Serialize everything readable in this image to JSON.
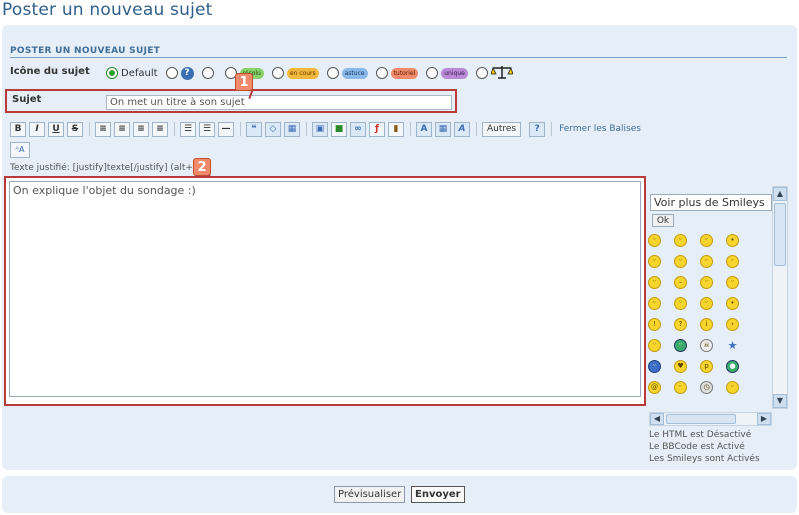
{
  "page": {
    "title": "Poster un nouveau sujet"
  },
  "form": {
    "heading": "POSTER UN NOUVEAU SUJET",
    "icon_label": "Icône du sujet",
    "icon_options": [
      {
        "label": "Default",
        "selected": true,
        "icon": "none"
      },
      {
        "label": "",
        "selected": false,
        "icon": "question-icon"
      },
      {
        "label": "",
        "selected": false,
        "icon": "blank"
      },
      {
        "label": "résolu",
        "selected": false,
        "icon": "resolu-icon"
      },
      {
        "label": "en cours",
        "selected": false,
        "icon": "en-cours-icon"
      },
      {
        "label": "astuce",
        "selected": false,
        "icon": "astuce-icon"
      },
      {
        "label": "tutoriel",
        "selected": false,
        "icon": "tutoriel-icon"
      },
      {
        "label": "unique",
        "selected": false,
        "icon": "unique-icon"
      },
      {
        "label": "",
        "selected": false,
        "icon": "scales-icon"
      }
    ],
    "subject_label": "Sujet",
    "subject_value": "On met un titre à son sujet",
    "badge1": "1",
    "badge2": "2",
    "toolbar_autres": "Autres",
    "toolbar_close_tags": "Fermer les Balises",
    "hint": "Texte justifié: [justify]texte[/justify]  (alt+)",
    "message_value": "On explique l'objet du sondage :)"
  },
  "smileys": {
    "select_label": "Voir plus de Smileys",
    "ok_label": "Ok",
    "html_status": "Le HTML est Désactivé",
    "bbcode_status": "Le BBCode est Activé",
    "smileys_status": "Les Smileys sont Activés"
  },
  "actions": {
    "preview": "Prévisualiser",
    "send": "Envoyer"
  },
  "colors": {
    "accent": "#2f5f8a",
    "panel": "#e6eff7",
    "annotation": "#b83a3a"
  }
}
